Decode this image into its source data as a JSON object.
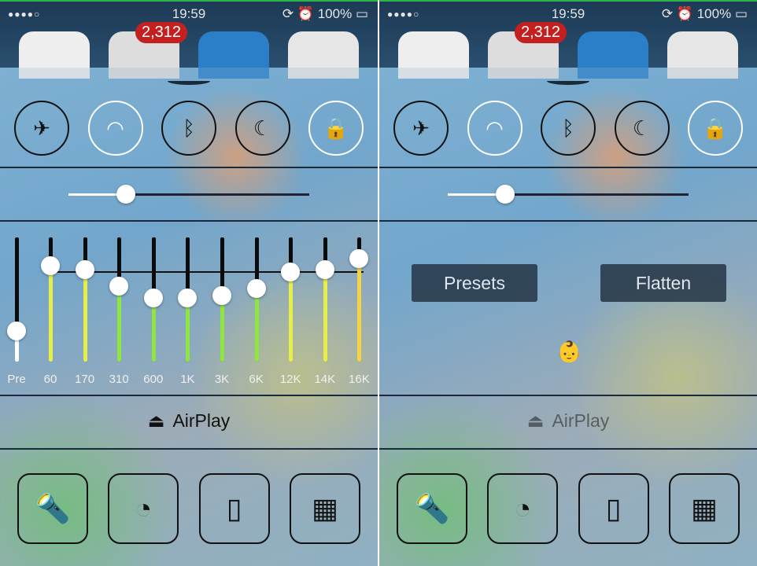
{
  "status": {
    "signal": "●●●●○",
    "time": "19:59",
    "battery": "100%"
  },
  "badge": "2,312",
  "toggles": [
    {
      "name": "airplane",
      "glyph": "✈",
      "on": false
    },
    {
      "name": "wifi",
      "glyph": "◠",
      "on": true
    },
    {
      "name": "bluetooth",
      "glyph": "ᛒ",
      "on": false
    },
    {
      "name": "do-not-disturb",
      "glyph": "☾",
      "on": false
    },
    {
      "name": "rotation-lock",
      "glyph": "🔒",
      "on": true
    }
  ],
  "brightness": 0.24,
  "eq": {
    "bands": [
      {
        "label": "Pre",
        "level": 0.25
      },
      {
        "label": "60",
        "level": 0.77
      },
      {
        "label": "170",
        "level": 0.74
      },
      {
        "label": "310",
        "level": 0.61
      },
      {
        "label": "600",
        "level": 0.51
      },
      {
        "label": "1K",
        "level": 0.51
      },
      {
        "label": "3K",
        "level": 0.53
      },
      {
        "label": "6K",
        "level": 0.59
      },
      {
        "label": "12K",
        "level": 0.72
      },
      {
        "label": "14K",
        "level": 0.74
      },
      {
        "label": "16K",
        "level": 0.83
      }
    ]
  },
  "buttons": {
    "presets": "Presets",
    "flatten": "Flatten"
  },
  "airplay": "AirPlay",
  "shortcuts": [
    "flashlight",
    "timer",
    "phone-vibrate",
    "calculator"
  ]
}
